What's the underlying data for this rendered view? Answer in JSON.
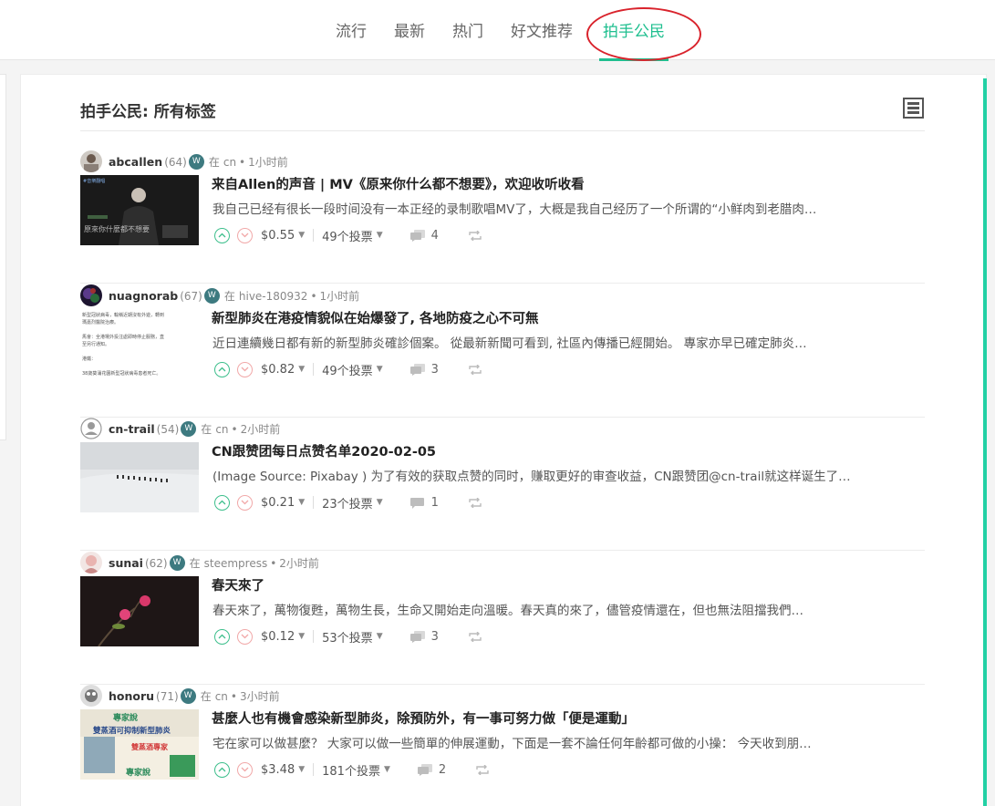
{
  "nav": {
    "tabs": [
      {
        "label": "流行"
      },
      {
        "label": "最新"
      },
      {
        "label": "热门"
      },
      {
        "label": "好文推荐"
      },
      {
        "label": "拍手公民",
        "active": true
      }
    ],
    "accent_color": "#1fbf8f"
  },
  "feed": {
    "title": "拍手公民: 所有标签",
    "posts": [
      {
        "author": "abcallen",
        "reputation": "(64)",
        "in_label": "在",
        "category": "cn",
        "time": "1小时前",
        "title": "来自Allen的声音 | MV《原来你什么都不想要》，欢迎收听收看",
        "excerpt": "我自己已经有很长一段时间没有一本正经的录制歌唱MV了，大概是我自己经历了一个所谓的“小鲜肉到老腊肉…",
        "payout": "$0.55",
        "votes": "49个投票",
        "comments": "4",
        "thumb_caption": "原來你什麼都不想要",
        "thumb_tag": "#音樂翻唱"
      },
      {
        "author": "nuagnorab",
        "reputation": "(67)",
        "in_label": "在",
        "category": "hive-180932",
        "time": "1小时前",
        "title": "新型肺炎在港疫情貌似在始爆發了, 各地防疫之心不可無",
        "excerpt": "近日連續幾日都有新的新型肺炎確診個案。 從最新新聞可看到, 社區內傳播已經開始。 專家亦早已確定肺炎…",
        "payout": "$0.82",
        "votes": "49个投票",
        "comments": "3",
        "thumb_lines": [
          "新型冠狀病毒，輸稱近期沒有外遊，轉到",
          "瑪嘉烈醫院治療。",
          "",
          "馬會：全港場外投注處即時停止服務，直",
          "至另行通知。",
          "",
          "港鐵：",
          "",
          "38歲葵涌花園新型冠狀病毒患者死亡。"
        ]
      },
      {
        "author": "cn-trail",
        "reputation": "(54)",
        "in_label": "在",
        "category": "cn",
        "time": "2小时前",
        "title": "CN跟赞团每日点赞名单2020-02-05",
        "excerpt": "(Image Source: Pixabay ) 为了有效的获取点赞的同时，赚取更好的审查收益，CN跟赞团@cn-trail就这样诞生了…",
        "payout": "$0.21",
        "votes": "23个投票",
        "comments": "1"
      },
      {
        "author": "sunai",
        "reputation": "(62)",
        "in_label": "在",
        "category": "steempress",
        "time": "2小时前",
        "title": "春天來了",
        "excerpt": "春天來了，萬物復甦，萬物生長，生命又開始走向溫暖。春天真的來了，儘管疫情還在，但也無法阻擋我們…",
        "payout": "$0.12",
        "votes": "53个投票",
        "comments": "3"
      },
      {
        "author": "honoru",
        "reputation": "(71)",
        "in_label": "在",
        "category": "cn",
        "time": "3小时前",
        "title": "甚麼人也有機會感染新型肺炎，除預防外，有一事可努力做「便是運動」",
        "excerpt": "宅在家可以做甚麼？ 大家可以做一些簡單的伸展運動，下面是一套不論任何年齡都可做的小操： 今天收到朋…",
        "payout": "$3.48",
        "votes": "181个投票",
        "comments": "2",
        "thumb_lines": [
          "專家說",
          "雙蒸酒可抑制新型肺炎",
          "雙蒸酒專家",
          "專家說"
        ]
      }
    ]
  }
}
